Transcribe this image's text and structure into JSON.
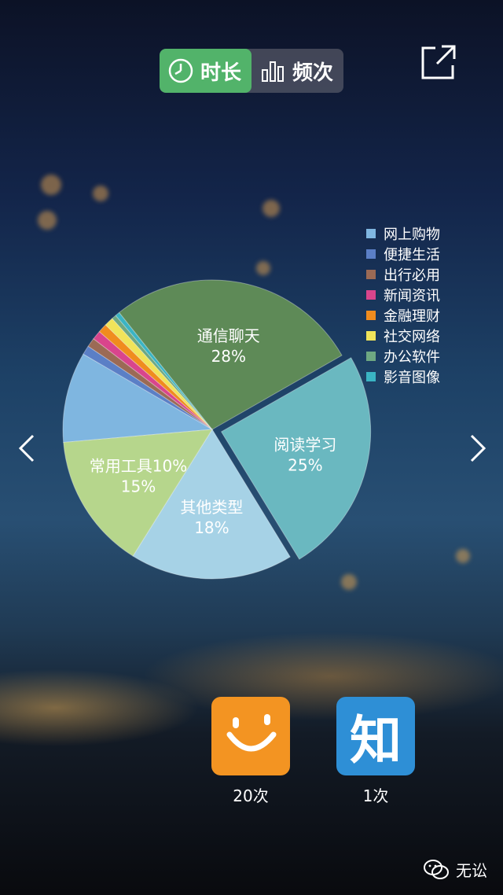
{
  "toggle": {
    "active_label": "时长",
    "inactive_label": "频次",
    "active_icon": "clock-icon",
    "inactive_icon": "bar-chart-icon",
    "active_color": "#52b36a"
  },
  "share_icon": "share-icon",
  "nav": {
    "prev_icon": "chevron-left-icon",
    "next_icon": "chevron-right-icon"
  },
  "chart_data": {
    "type": "pie",
    "title": "",
    "series": [
      {
        "name": "网上购物",
        "value": 10,
        "label": "10%",
        "color": "#7fb6e0"
      },
      {
        "name": "便捷生活",
        "value": 1,
        "label": "",
        "color": "#5b7fc6"
      },
      {
        "name": "出行必用",
        "value": 1,
        "label": "",
        "color": "#9b6a55"
      },
      {
        "name": "新闻资讯",
        "value": 1,
        "label": "",
        "color": "#d9458c"
      },
      {
        "name": "金融理财",
        "value": 1,
        "label": "",
        "color": "#f08c1e"
      },
      {
        "name": "社交网络",
        "value": 1,
        "label": "",
        "color": "#f0e45a"
      },
      {
        "name": "办公软件",
        "value": 0.5,
        "label": "",
        "color": "#6ea882"
      },
      {
        "name": "影音图像",
        "value": 0.5,
        "label": "",
        "color": "#3ab4c4"
      },
      {
        "name": "通信聊天",
        "value": 28,
        "label": "28%",
        "color": "#5e8a57"
      },
      {
        "name": "阅读学习",
        "value": 25,
        "label": "25%",
        "color": "#6ab8c0"
      },
      {
        "name": "其他类型",
        "value": 18,
        "label": "18%",
        "color": "#a6d2e6"
      },
      {
        "name": "常用工具",
        "value": 15,
        "label": "15%",
        "color": "#b6d68c"
      }
    ],
    "exploded": "阅读学习",
    "legend": {
      "placement": "right",
      "items": [
        "网上购物",
        "便捷生活",
        "出行必用",
        "新闻资讯",
        "金融理财",
        "社交网络",
        "办公软件",
        "影音图像"
      ]
    }
  },
  "apps": [
    {
      "icon": "smile-icon",
      "count": "20次",
      "color": "#f39422"
    },
    {
      "icon": "zhi-icon",
      "glyph": "知",
      "count": "1次",
      "color": "#2e8fd6"
    }
  ],
  "watermark": {
    "icon": "wechat-icon",
    "text": "无讼"
  }
}
